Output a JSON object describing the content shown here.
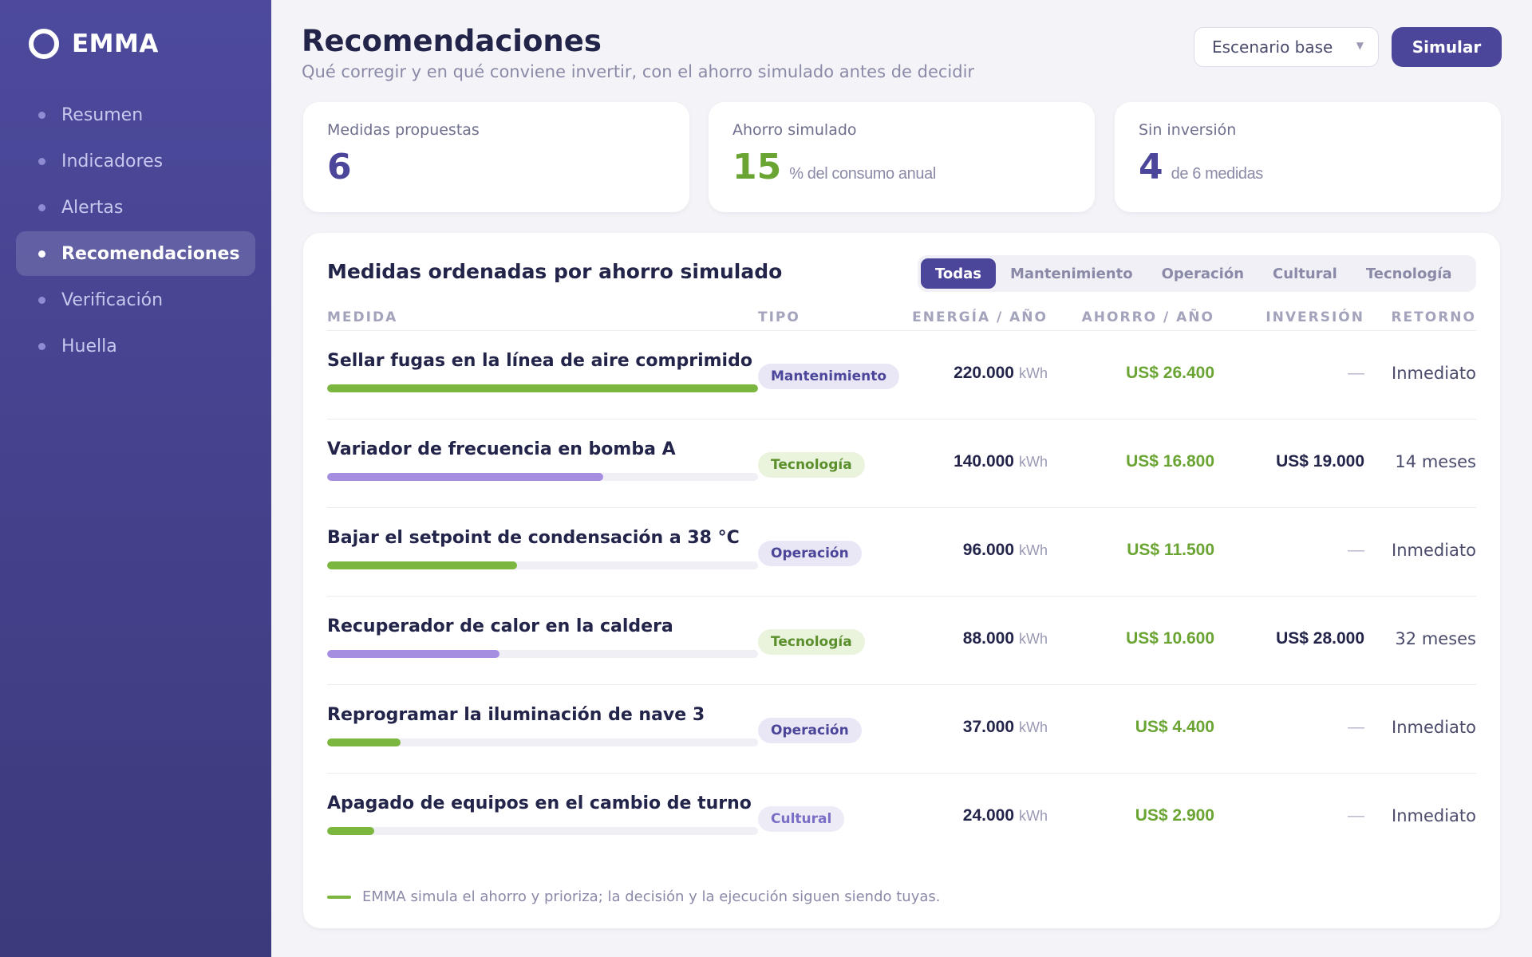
{
  "brand": {
    "name": "EMMA"
  },
  "nav": [
    {
      "label": "Resumen",
      "active": false
    },
    {
      "label": "Indicadores",
      "active": false
    },
    {
      "label": "Alertas",
      "active": false
    },
    {
      "label": "Recomendaciones",
      "active": true
    },
    {
      "label": "Verificación",
      "active": false
    },
    {
      "label": "Huella",
      "active": false
    }
  ],
  "header": {
    "title": "Recomendaciones",
    "subtitle": "Qué corregir y en qué conviene invertir, con el ahorro simulado antes de decidir",
    "scenario": "Escenario base",
    "simulate_label": "Simular"
  },
  "kpis": [
    {
      "label": "Medidas propuestas",
      "value": "6",
      "unit": ""
    },
    {
      "label": "Ahorro simulado",
      "value": "15",
      "unit": "% del consumo anual"
    },
    {
      "label": "Sin inversión",
      "value": "4",
      "unit": "de 6 medidas"
    }
  ],
  "panel": {
    "title": "Medidas ordenadas por ahorro simulado",
    "filters": [
      "Todas",
      "Mantenimiento",
      "Operación",
      "Cultural",
      "Tecnología"
    ],
    "active_filter": "Todas",
    "columns": {
      "measure": "MEDIDA",
      "type": "TIPO",
      "energy": "ENERGÍA / AÑO",
      "saving": "AHORRO / AÑO",
      "investment": "INVERSIÓN",
      "return": "RETORNO"
    },
    "rows": [
      {
        "name": "Sellar fugas en la línea de aire comprimido",
        "type": "Mantenimiento",
        "energy": "220.000",
        "energy_unit": "kWh",
        "saving": "US$ 26.400",
        "investment": "—",
        "return": "Inmediato",
        "bar": 1.0,
        "bar_color": "#7bb63e"
      },
      {
        "name": "Variador de frecuencia en bomba A",
        "type": "Tecnología",
        "energy": "140.000",
        "energy_unit": "kWh",
        "saving": "US$ 16.800",
        "investment": "US$ 19.000",
        "return": "14 meses",
        "bar": 0.64,
        "bar_color": "#a58ee0"
      },
      {
        "name": "Bajar el setpoint de condensación a 38 °C",
        "type": "Operación",
        "energy": "96.000",
        "energy_unit": "kWh",
        "saving": "US$ 11.500",
        "investment": "—",
        "return": "Inmediato",
        "bar": 0.44,
        "bar_color": "#7bb63e"
      },
      {
        "name": "Recuperador de calor en la caldera",
        "type": "Tecnología",
        "energy": "88.000",
        "energy_unit": "kWh",
        "saving": "US$ 10.600",
        "investment": "US$ 28.000",
        "return": "32 meses",
        "bar": 0.4,
        "bar_color": "#a58ee0"
      },
      {
        "name": "Reprogramar la iluminación de nave 3",
        "type": "Operación",
        "energy": "37.000",
        "energy_unit": "kWh",
        "saving": "US$ 4.400",
        "investment": "—",
        "return": "Inmediato",
        "bar": 0.17,
        "bar_color": "#7bb63e"
      },
      {
        "name": "Apagado de equipos en el cambio de turno",
        "type": "Cultural",
        "energy": "24.000",
        "energy_unit": "kWh",
        "saving": "US$ 2.900",
        "investment": "—",
        "return": "Inmediato",
        "bar": 0.11,
        "bar_color": "#7bb63e"
      }
    ],
    "footnote": "EMMA simula el ahorro y prioriza; la decisión y la ejecución siguen siendo tuyas."
  }
}
